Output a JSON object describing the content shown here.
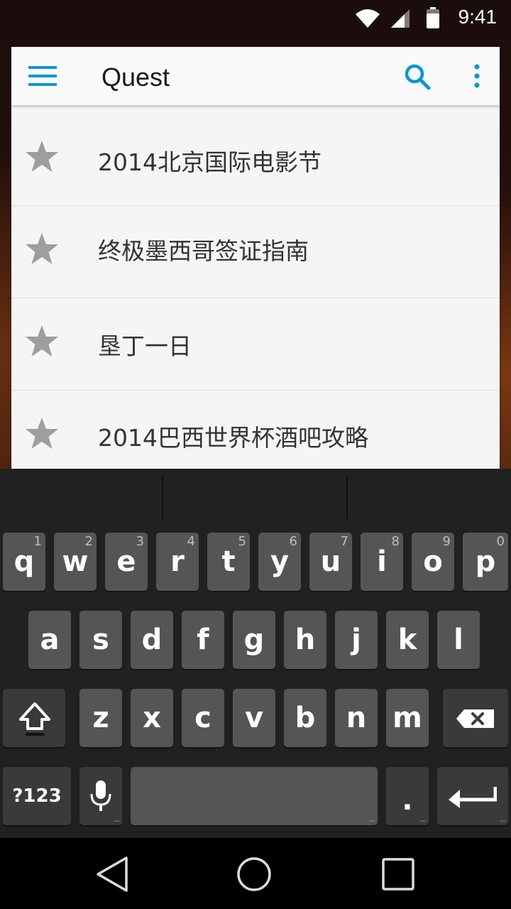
{
  "status_bar": {
    "time": "9:41",
    "icons": [
      "wifi-icon",
      "signal-icon",
      "battery-icon"
    ]
  },
  "toolbar": {
    "title": "Quest",
    "menu_icon": "menu-icon",
    "search_icon": "search-icon",
    "more_icon": "more-vert-icon",
    "accent_color": "#0a96d8"
  },
  "list": {
    "items": [
      {
        "label": "2014北京国际电影节",
        "icon": "star-icon"
      },
      {
        "label": "终极墨西哥签证指南",
        "icon": "star-icon"
      },
      {
        "label": "垦丁一日",
        "icon": "star-icon"
      },
      {
        "label": "2014巴西世界杯酒吧攻略",
        "icon": "star-icon"
      }
    ]
  },
  "keyboard": {
    "row1": [
      {
        "key": "q",
        "hint": "1"
      },
      {
        "key": "w",
        "hint": "2"
      },
      {
        "key": "e",
        "hint": "3"
      },
      {
        "key": "r",
        "hint": "4"
      },
      {
        "key": "t",
        "hint": "5"
      },
      {
        "key": "y",
        "hint": "6"
      },
      {
        "key": "u",
        "hint": "7"
      },
      {
        "key": "i",
        "hint": "8"
      },
      {
        "key": "o",
        "hint": "9"
      },
      {
        "key": "p",
        "hint": "0"
      }
    ],
    "row2": [
      "a",
      "s",
      "d",
      "f",
      "g",
      "h",
      "j",
      "k",
      "l"
    ],
    "row3": [
      "z",
      "x",
      "c",
      "v",
      "b",
      "n",
      "m"
    ],
    "symbols_label": "?123",
    "period_label": ".",
    "more_dots": "...",
    "shift_icon": "shift-icon",
    "backspace_icon": "backspace-icon",
    "mic_icon": "mic-icon",
    "enter_icon": "enter-icon"
  },
  "nav_bar": {
    "icons": [
      "back-icon",
      "home-icon",
      "recents-icon"
    ]
  }
}
